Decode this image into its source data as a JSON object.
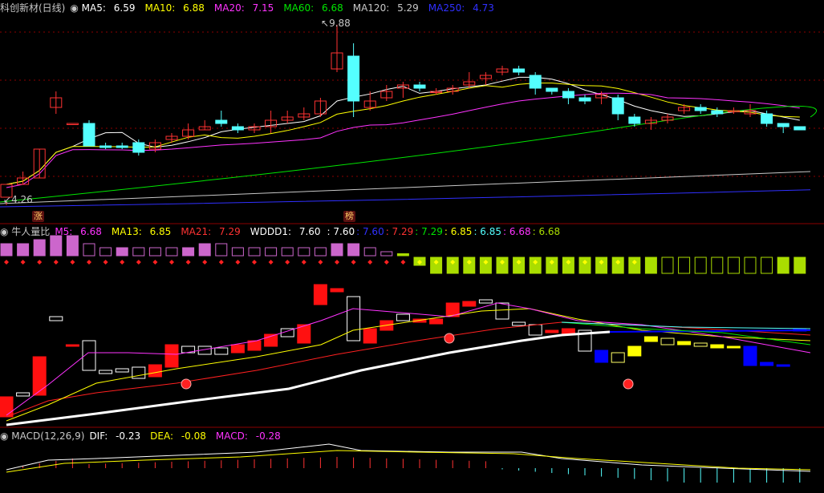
{
  "main_header": {
    "title": "科创新材(日线)",
    "ma5_label": "MA5:",
    "ma5": "6.59",
    "ma10_label": "MA10:",
    "ma10": "6.88",
    "ma20_label": "MA20:",
    "ma20": "7.15",
    "ma60_label": "MA60:",
    "ma60": "6.68",
    "ma120_label": "MA120:",
    "ma120": "5.29",
    "ma250_label": "MA250:",
    "ma250": "4.73"
  },
  "main_annotations": {
    "high_price": "9.88",
    "low_price": "4.26",
    "badge_up": "涨",
    "badge_list": "榜"
  },
  "volume_header": {
    "title": "牛人量比",
    "m5_label": "M5:",
    "m5": "6.68",
    "ma13_label": "MA13:",
    "ma13": "6.85",
    "ma21_label": "MA21:",
    "ma21": "7.29",
    "wddd_label": "WDDD1:",
    "wddd1": "7.60",
    "v1": ": 7.60",
    "v2": ": 7.60",
    "v3": ": 7.29",
    "v4": ": 7.29",
    "v5": ": 6.85",
    "v6": ": 6.85",
    "v7": ": 6.68",
    "v8": ": 6.68"
  },
  "macd_header": {
    "title": "MACD(12,26,9)",
    "dif_label": "DIF:",
    "dif": "-0.23",
    "dea_label": "DEA:",
    "dea": "-0.08",
    "macd_label": "MACD:",
    "macd": "-0.28"
  },
  "colors": {
    "up": "#ff3232",
    "down": "#54ffff",
    "ma5": "#ffffff",
    "ma10": "#ffff00",
    "ma20": "#ff33ff",
    "ma60": "#00e600",
    "ma120": "#c8c8c8",
    "ma250": "#3030ff",
    "grid": "#8b0000",
    "lime": "#aadd00",
    "blue_bar": "#0000ff"
  },
  "candles": [
    [
      4.5,
      4.9,
      4.35,
      4.26
    ],
    [
      4.9,
      5.1,
      4.9,
      5.3
    ],
    [
      5.1,
      6.0,
      5.1,
      6.0
    ],
    [
      7.3,
      7.6,
      7.1,
      7.8
    ],
    [
      6.8,
      6.8,
      6.8,
      6.8
    ],
    [
      6.8,
      6.1,
      6.1,
      6.9
    ],
    [
      6.1,
      6.05,
      6.0,
      6.2
    ],
    [
      6.1,
      6.05,
      6.0,
      6.2
    ],
    [
      6.2,
      5.9,
      5.8,
      6.3
    ],
    [
      6.0,
      6.2,
      5.9,
      6.3
    ],
    [
      6.3,
      6.4,
      6.2,
      6.5
    ],
    [
      6.4,
      6.6,
      6.3,
      6.8
    ],
    [
      6.6,
      6.7,
      6.6,
      6.9
    ],
    [
      6.9,
      6.8,
      6.7,
      7.2
    ],
    [
      6.7,
      6.6,
      6.5,
      6.8
    ],
    [
      6.6,
      6.7,
      6.5,
      6.8
    ],
    [
      6.7,
      6.9,
      6.5,
      7.2
    ],
    [
      6.9,
      7.0,
      6.8,
      7.2
    ],
    [
      7.0,
      7.1,
      6.9,
      7.3
    ],
    [
      7.1,
      7.5,
      7.0,
      7.6
    ],
    [
      8.5,
      9.0,
      8.4,
      9.88
    ],
    [
      8.9,
      7.5,
      7.0,
      9.3
    ],
    [
      7.3,
      7.5,
      7.2,
      7.8
    ],
    [
      7.6,
      7.8,
      7.5,
      8.0
    ],
    [
      7.9,
      8.0,
      7.6,
      8.1
    ],
    [
      8.0,
      7.9,
      7.8,
      8.1
    ],
    [
      7.8,
      7.8,
      7.7,
      7.9
    ],
    [
      7.8,
      7.9,
      7.7,
      8.0
    ],
    [
      8.0,
      8.1,
      7.9,
      8.4
    ],
    [
      8.2,
      8.3,
      8.0,
      8.4
    ],
    [
      8.4,
      8.5,
      8.3,
      8.6
    ],
    [
      8.5,
      8.4,
      8.3,
      8.6
    ],
    [
      8.3,
      7.9,
      7.7,
      8.4
    ],
    [
      7.9,
      7.8,
      7.7,
      7.9
    ],
    [
      7.8,
      7.6,
      7.4,
      7.9
    ],
    [
      7.6,
      7.5,
      7.4,
      7.7
    ],
    [
      7.6,
      7.7,
      7.4,
      7.8
    ],
    [
      7.6,
      7.1,
      6.9,
      7.7
    ],
    [
      7.0,
      6.8,
      6.7,
      7.1
    ],
    [
      6.8,
      6.9,
      6.6,
      7.0
    ],
    [
      6.9,
      7.0,
      6.8,
      7.1
    ],
    [
      7.2,
      7.3,
      7.1,
      7.4
    ],
    [
      7.3,
      7.2,
      7.1,
      7.4
    ],
    [
      7.2,
      7.1,
      7.0,
      7.3
    ],
    [
      7.2,
      7.2,
      7.1,
      7.3
    ],
    [
      7.1,
      7.2,
      7.0,
      7.4
    ],
    [
      7.1,
      6.8,
      6.7,
      7.2
    ],
    [
      6.8,
      6.7,
      6.5,
      6.8
    ],
    [
      6.7,
      6.6,
      6.6,
      6.7
    ]
  ],
  "vol_bars": [
    3,
    3,
    4,
    5,
    5,
    3,
    2,
    2,
    2,
    2,
    2,
    2,
    3,
    3,
    2,
    2,
    2,
    2,
    2,
    2,
    3,
    3,
    2,
    1,
    0.5,
    -0.5,
    -1,
    -1,
    -1,
    -1,
    -1,
    -1,
    -1,
    -1,
    -1,
    -1,
    -1,
    -1,
    -1,
    -1,
    -1,
    -1,
    -1,
    -1,
    -1,
    -1,
    -1,
    -1,
    -1
  ],
  "vol_bar_colors": [
    "#cc66cc",
    "#cc66cc",
    "#cc66cc",
    "#cc66cc",
    "#cc66cc",
    "#000",
    "#000",
    "#cc66cc",
    "#000",
    "#000",
    "#000",
    "#cc66cc",
    "#cc66cc",
    "#000",
    "#000",
    "#000",
    "#000",
    "#000",
    "#000",
    "#000",
    "#cc66cc",
    "#cc66cc",
    "#000",
    "#000",
    "#aadd00",
    "#aadd00",
    "#aadd00",
    "#aadd00",
    "#aadd00",
    "#aadd00",
    "#aadd00",
    "#aadd00",
    "#aadd00",
    "#aadd00",
    "#aadd00",
    "#aadd00",
    "#aadd00",
    "#aadd00",
    "#aadd00",
    "#aadd00",
    "#000",
    "#000",
    "#000",
    "#000",
    "#000",
    "#000",
    "#000",
    "#aadd00",
    "#aadd00"
  ]
}
